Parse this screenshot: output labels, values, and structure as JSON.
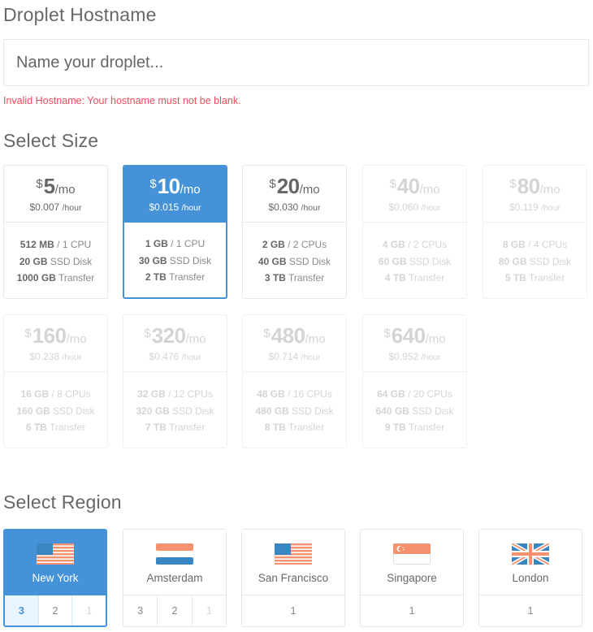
{
  "hostname": {
    "title": "Droplet Hostname",
    "placeholder": "Name your droplet...",
    "value": "",
    "error": "Invalid Hostname: Your hostname must not be blank."
  },
  "size": {
    "title": "Select Size",
    "currency": "$",
    "per_month": "/mo",
    "per_hour": "/hour",
    "selected_index": 1,
    "plans": [
      {
        "price": "5",
        "hourly": "$0.007",
        "ram": "512 MB",
        "cpu": "1 CPU",
        "disk": "20 GB",
        "disk_label": "SSD Disk",
        "transfer": "1000 GB",
        "transfer_label": "Transfer",
        "state": "available"
      },
      {
        "price": "10",
        "hourly": "$0.015",
        "ram": "1 GB",
        "cpu": "1 CPU",
        "disk": "30 GB",
        "disk_label": "SSD Disk",
        "transfer": "2 TB",
        "transfer_label": "Transfer",
        "state": "selected"
      },
      {
        "price": "20",
        "hourly": "$0.030",
        "ram": "2 GB",
        "cpu": "2 CPUs",
        "disk": "40 GB",
        "disk_label": "SSD Disk",
        "transfer": "3 TB",
        "transfer_label": "Transfer",
        "state": "available"
      },
      {
        "price": "40",
        "hourly": "$0.060",
        "ram": "4 GB",
        "cpu": "2 CPUs",
        "disk": "60 GB",
        "disk_label": "SSD Disk",
        "transfer": "4 TB",
        "transfer_label": "Transfer",
        "state": "disabled"
      },
      {
        "price": "80",
        "hourly": "$0.119",
        "ram": "8 GB",
        "cpu": "4 CPUs",
        "disk": "80 GB",
        "disk_label": "SSD Disk",
        "transfer": "5 TB",
        "transfer_label": "Transfer",
        "state": "disabled"
      },
      {
        "price": "160",
        "hourly": "$0.238",
        "ram": "16 GB",
        "cpu": "8 CPUs",
        "disk": "160 GB",
        "disk_label": "SSD Disk",
        "transfer": "6 TB",
        "transfer_label": "Transfer",
        "state": "disabled"
      },
      {
        "price": "320",
        "hourly": "$0.476",
        "ram": "32 GB",
        "cpu": "12 CPUs",
        "disk": "320 GB",
        "disk_label": "SSD Disk",
        "transfer": "7 TB",
        "transfer_label": "Transfer",
        "state": "disabled"
      },
      {
        "price": "480",
        "hourly": "$0.714",
        "ram": "48 GB",
        "cpu": "16 CPUs",
        "disk": "480 GB",
        "disk_label": "SSD Disk",
        "transfer": "8 TB",
        "transfer_label": "Transfer",
        "state": "disabled"
      },
      {
        "price": "640",
        "hourly": "$0.952",
        "ram": "64 GB",
        "cpu": "20 CPUs",
        "disk": "640 GB",
        "disk_label": "SSD Disk",
        "transfer": "9 TB",
        "transfer_label": "Transfer",
        "state": "disabled"
      }
    ]
  },
  "region": {
    "title": "Select Region",
    "selected_index": 0,
    "regions": [
      {
        "name": "New York",
        "flag": "us-flag-icon",
        "datacenters": [
          {
            "label": "3",
            "state": "active"
          },
          {
            "label": "2",
            "state": "normal"
          },
          {
            "label": "1",
            "state": "faded"
          }
        ],
        "state": "selected"
      },
      {
        "name": "Amsterdam",
        "flag": "nl-flag-icon",
        "datacenters": [
          {
            "label": "3",
            "state": "normal"
          },
          {
            "label": "2",
            "state": "normal"
          },
          {
            "label": "1",
            "state": "faded"
          }
        ],
        "state": "available"
      },
      {
        "name": "San Francisco",
        "flag": "us-flag-icon",
        "datacenters": [
          {
            "label": "1",
            "state": "normal"
          }
        ],
        "state": "available"
      },
      {
        "name": "Singapore",
        "flag": "sg-flag-icon",
        "datacenters": [
          {
            "label": "1",
            "state": "normal"
          }
        ],
        "state": "available"
      },
      {
        "name": "London",
        "flag": "uk-flag-icon",
        "datacenters": [
          {
            "label": "1",
            "state": "normal"
          }
        ],
        "state": "available"
      }
    ]
  },
  "colors": {
    "accent": "#4592d8",
    "error": "#ef4b5c",
    "text": "#676767",
    "disabled_text": "#d4d4d4",
    "flag_red": "#f4916e",
    "flag_blue": "#3a86c3"
  }
}
